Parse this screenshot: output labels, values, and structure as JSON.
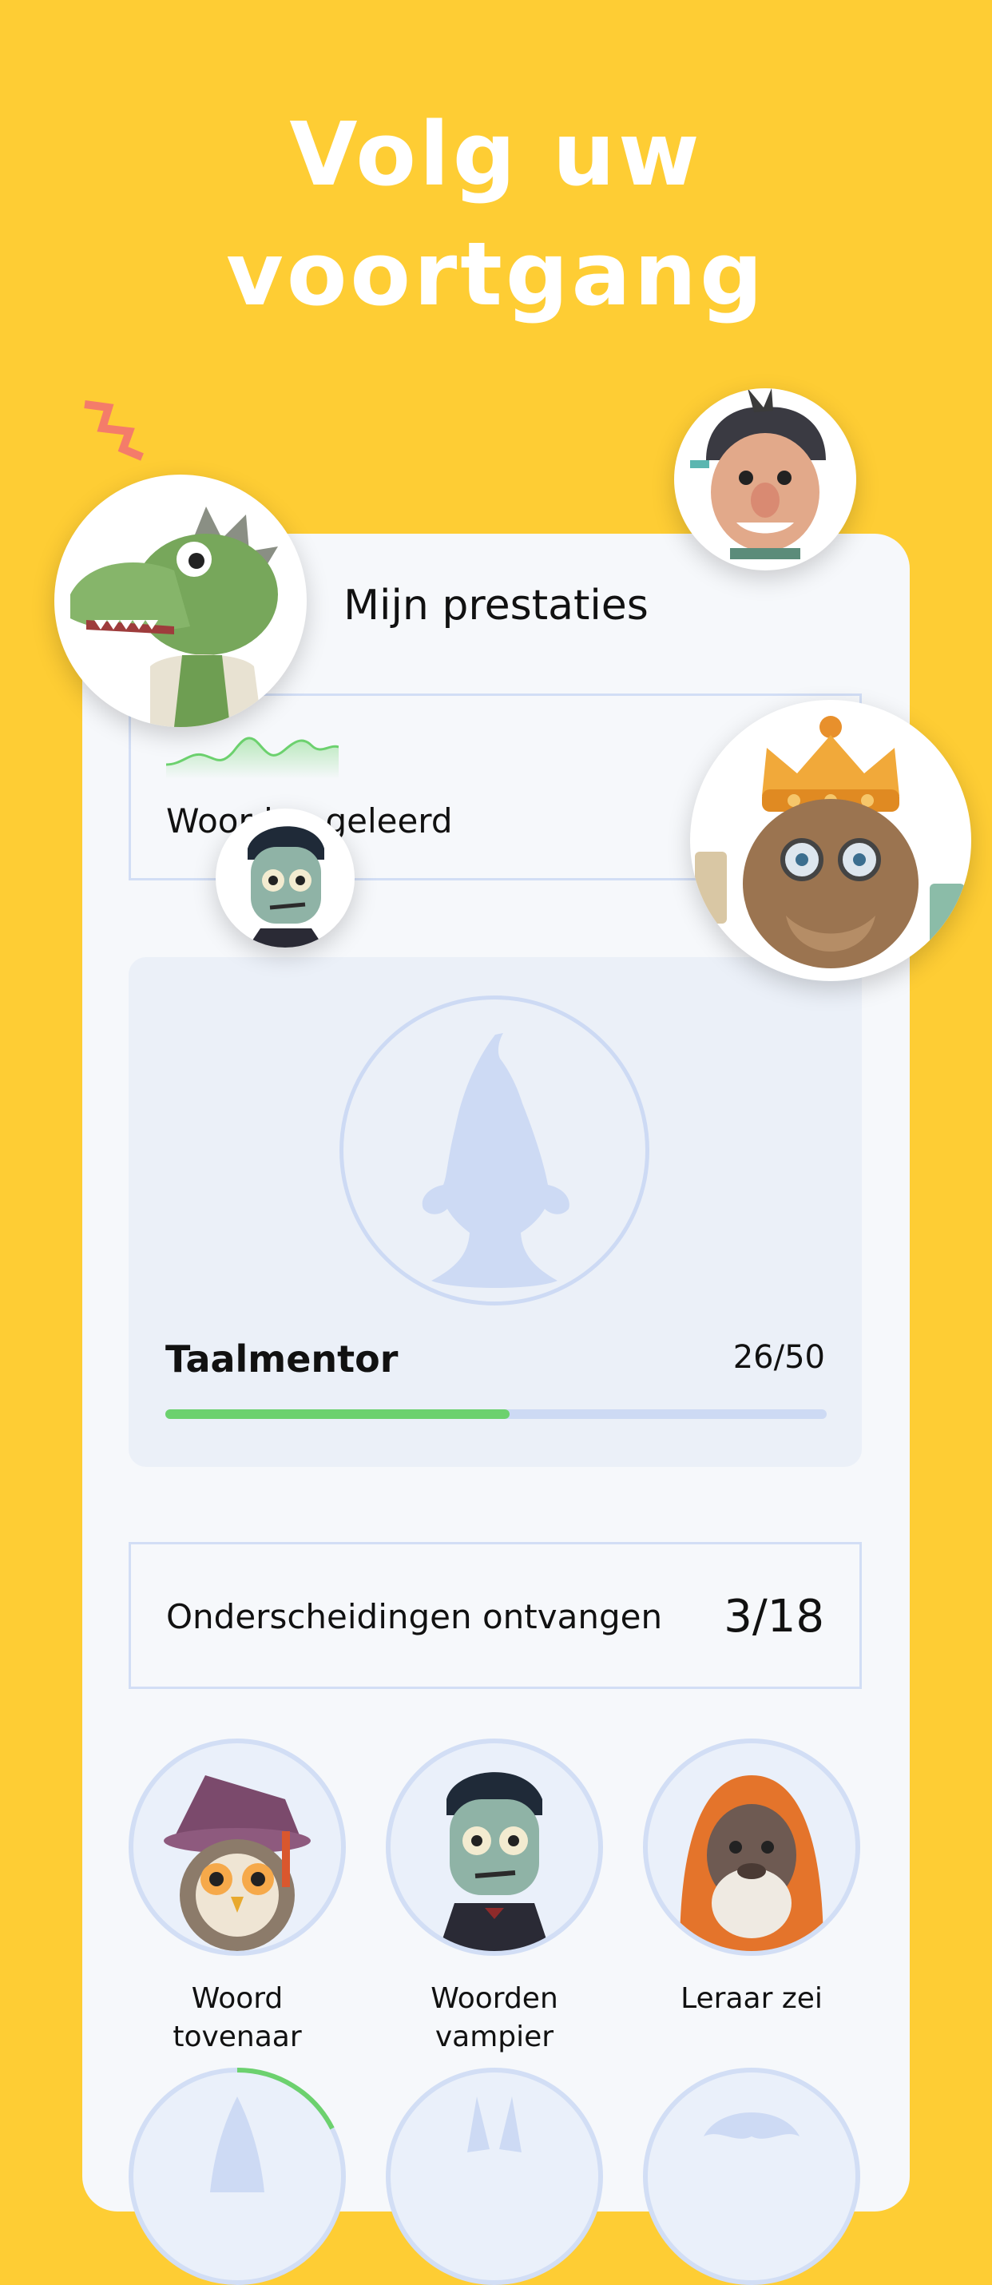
{
  "headline": {
    "line1": "Volg uw",
    "line2": "voortgang"
  },
  "card": {
    "title": "Mijn prestaties",
    "words_learned": {
      "label": "Woorden geleerd"
    },
    "mentor": {
      "name": "Taalmentor",
      "count": "26/50",
      "progress": 0.52
    },
    "awards": {
      "label": "Onderscheidingen ontvangen",
      "count": "3/18"
    },
    "badges": [
      {
        "label": "Woord tovenaar"
      },
      {
        "label": "Woorden vampier"
      },
      {
        "label": "Leraar zei"
      }
    ]
  },
  "icons": {
    "crocodile": "crocodile-avatar-icon",
    "caveman": "caveman-avatar-icon",
    "king": "king-avatar-icon",
    "zombie": "zombie-avatar-icon",
    "gnome": "gnome-silhouette-icon",
    "owl": "owl-wizard-icon",
    "gorilla": "gorilla-teacher-icon"
  },
  "colors": {
    "background": "#FECD34",
    "accent_green": "#6CD16E",
    "outline_blue": "#CDDAF4",
    "squiggle": "#F47C6A"
  }
}
